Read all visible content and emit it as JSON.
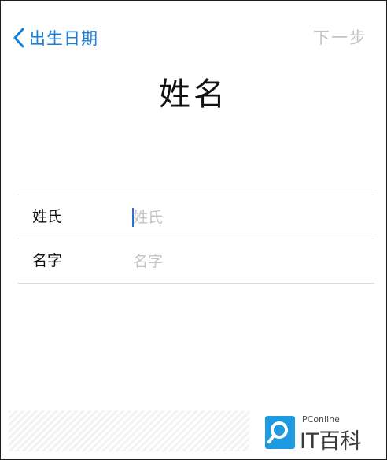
{
  "nav": {
    "back_label": "出生日期",
    "next_label": "下一步"
  },
  "title": "姓名",
  "form": {
    "fields": [
      {
        "label": "姓氏",
        "placeholder": "姓氏",
        "value": ""
      },
      {
        "label": "名字",
        "placeholder": "名字",
        "value": ""
      }
    ]
  },
  "watermark": {
    "small_text": "PConline",
    "big_text": "IT百科"
  },
  "colors": {
    "accent": "#1a7fd6",
    "disabled": "#c4c4c4",
    "divider": "#dcdcdc",
    "caret": "#2e6fd6",
    "watermark_badge": "#1e9be0"
  },
  "icons": {
    "back": "chevron-left-icon",
    "watermark": "magnifier-icon"
  }
}
